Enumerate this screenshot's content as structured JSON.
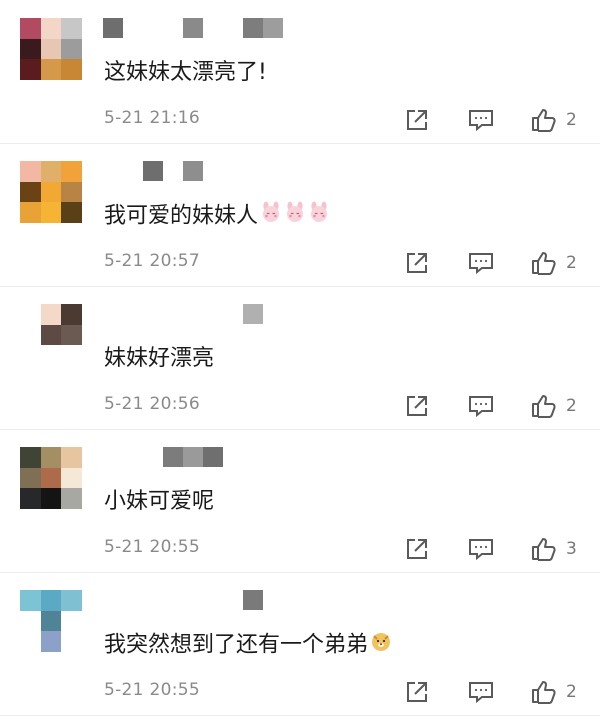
{
  "colors": {
    "text": "#1a1a1a",
    "meta": "#8a8a8a",
    "icon": "#5a5a5a",
    "divider": "#ededed"
  },
  "comments": [
    {
      "avatar_tiles": [
        "#b24a62",
        "#f3d6c7",
        "#c7c7c7",
        "#3b1a1e",
        "#e7c6b3",
        "#9c9c9c",
        "#5b1c20",
        "#d49a4a",
        "#c88735"
      ],
      "username_tiles": [
        "#6e6e6e",
        "#ffffff",
        "#ffffff",
        "#ffffff",
        "#8a8a8a",
        "#ffffff",
        "#ffffff",
        "#7d7d7d",
        "#9d9d9d"
      ],
      "text": "这妹妹太漂亮了!",
      "time": "5-21 21:16",
      "likes": "2"
    },
    {
      "avatar_tiles": [
        "#f3b8a4",
        "#e0b06a",
        "#f2a23a",
        "#6a4214",
        "#f1a934",
        "#b88445",
        "#e9a236",
        "#f5b434",
        "#5a4016"
      ],
      "username_tiles": [
        "#ffffff",
        "#ffffff",
        "#6e6e6e",
        "#ffffff",
        "#8e8e8e",
        "#ffffff",
        "#ffffff",
        "#ffffff",
        "#ffffff"
      ],
      "text": "我可爱的妹妹人",
      "emoji_count": 3,
      "time": "5-21 20:57",
      "likes": "2"
    },
    {
      "avatar_tiles": [
        "#ffffff",
        "#f4d8c8",
        "#4a3a32",
        "#ffffff",
        "#5e4a44",
        "#6a5a52",
        "#ffffff",
        "#ffffff",
        "#ffffff"
      ],
      "username_tiles": [
        "#ffffff",
        "#ffffff",
        "#ffffff",
        "#ffffff",
        "#ffffff",
        "#ffffff",
        "#ffffff",
        "#b0b0b0",
        "#ffffff"
      ],
      "text": "妹妹好漂亮",
      "time": "5-21 20:56",
      "likes": "2"
    },
    {
      "avatar_tiles": [
        "#3f4434",
        "#a48e63",
        "#e7c5a0",
        "#7e6f55",
        "#ad6b4b",
        "#f6e8d7",
        "#26282a",
        "#141414",
        "#a8a8a2"
      ],
      "username_tiles": [
        "#ffffff",
        "#ffffff",
        "#ffffff",
        "#7c7c7c",
        "#9a9a9a",
        "#6f6f6f",
        "#ffffff",
        "#ffffff",
        "#ffffff"
      ],
      "text": "小妹可爱呢",
      "time": "5-21 20:55",
      "likes": "3"
    },
    {
      "avatar_tiles": [
        "#7cc3d4",
        "#5ba9c3",
        "#7fc1d3",
        "#ffffff",
        "#4f8398",
        "#ffffff",
        "#ffffff",
        "#8da1c8",
        "#ffffff"
      ],
      "username_tiles": [
        "#ffffff",
        "#ffffff",
        "#ffffff",
        "#ffffff",
        "#ffffff",
        "#ffffff",
        "#ffffff",
        "#7a7a7a",
        "#ffffff"
      ],
      "text": "我突然想到了还有一个弟弟",
      "emoji_count": 1,
      "emoji_type": "doge",
      "time": "5-21 20:55",
      "likes": "2"
    }
  ]
}
